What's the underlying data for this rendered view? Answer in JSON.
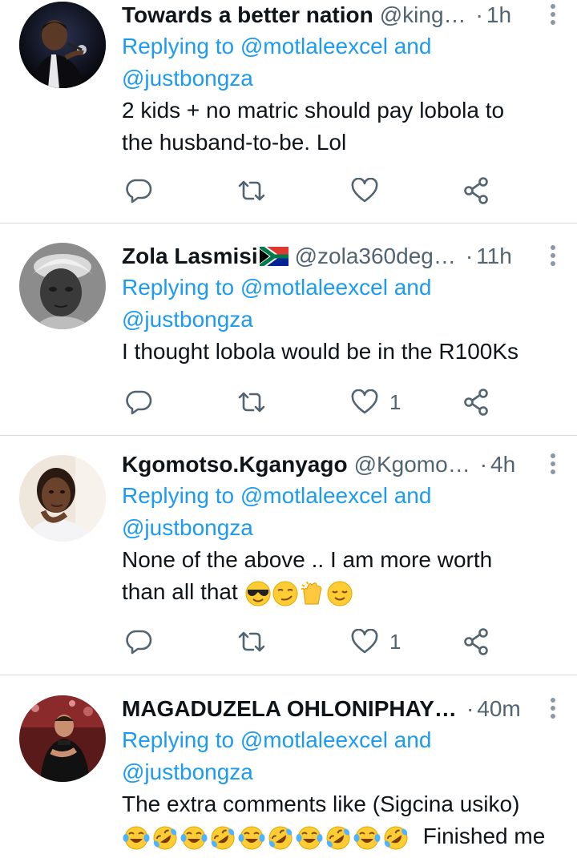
{
  "tweets": [
    {
      "display_name": "Towards a better nation",
      "handle": "@king…",
      "time": "1h",
      "reply_prefix": "Replying to",
      "mention1": "@motlaleexcel",
      "reply_and": "and",
      "mention2": "@justbongza",
      "text_lines": [
        "2 kids + no matric should pay lobola to",
        "the husband-to-be. Lol"
      ],
      "likes": ""
    },
    {
      "display_name": "Zola Lasmisi",
      "handle": "@zola360deg…",
      "time": "11h",
      "reply_prefix": "Replying to",
      "mention1": "@motlaleexcel",
      "reply_and": "and",
      "mention2": "@justbongza",
      "text_lines": [
        "I thought lobola would be in the R100Ks"
      ],
      "likes": "1"
    },
    {
      "display_name": "Kgomotso.Kganyago",
      "handle": "@Kgomo…",
      "time": "4h",
      "reply_prefix": "Replying to",
      "mention1": "@motlaleexcel",
      "reply_and": "and",
      "mention2": "@justbongza",
      "text_lines": [
        "None of the above .. I am more worth",
        "than all that"
      ],
      "likes": "1"
    },
    {
      "display_name": "MAGADUZELA OHLONIPHAY…",
      "handle": "",
      "time": "40m",
      "reply_prefix": "Replying to",
      "mention1": "@motlaleexcel",
      "reply_and": "and",
      "mention2": "@justbongza",
      "text_lines": [
        "The extra comments like (Sigcina usiko)",
        "Finished me"
      ],
      "likes": ""
    }
  ],
  "separator": "·",
  "icons": {
    "reply": "reply-icon",
    "retweet": "retweet-icon",
    "like": "heart-icon",
    "share": "share-icon",
    "more": "more-vertical-icon"
  },
  "colors": {
    "link": "#1d9bf0",
    "secondary_text": "#536471",
    "primary_text": "#0f1419",
    "divider": "#d6dbdf"
  }
}
